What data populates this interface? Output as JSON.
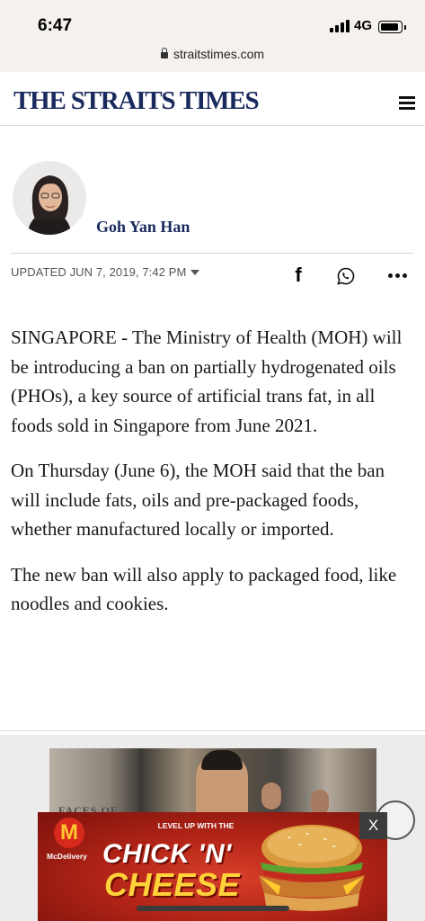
{
  "status_bar": {
    "time": "6:47",
    "network": "4G"
  },
  "browser": {
    "url": "straitstimes.com"
  },
  "header": {
    "masthead": "THE STRAITS TIMES"
  },
  "author": {
    "name": "Goh Yan Han"
  },
  "meta": {
    "updated": "UPDATED  JUN 7, 2019, 7:42 PM"
  },
  "share": {
    "facebook_glyph": "f"
  },
  "article": {
    "paragraphs": [
      "SINGAPORE - The Ministry of Health (MOH) will be introducing a ban on partially hydrogenated oils (PHOs), a key source of artificial trans fat, in all foods sold in Singapore from June 2021.",
      "On Thursday (June 6), the MOH said that the ban will include fats, oils and pre-packaged foods, whether manufactured locally or imported.",
      "The new ban will also apply to packaged food, like noodles and cookies."
    ]
  },
  "related": {
    "photo_text": "FACES OF"
  },
  "ad": {
    "logo": "M",
    "brand": "McDelivery",
    "tagline": "LEVEL UP WITH THE",
    "headline_1": "CHICK 'N'",
    "headline_2": "CHEESE",
    "close_label": "X"
  },
  "colors": {
    "masthead": "#1b2a5e",
    "author": "#1b2a5e",
    "ad_red": "#b32417",
    "ad_yellow": "#ffd23a"
  }
}
